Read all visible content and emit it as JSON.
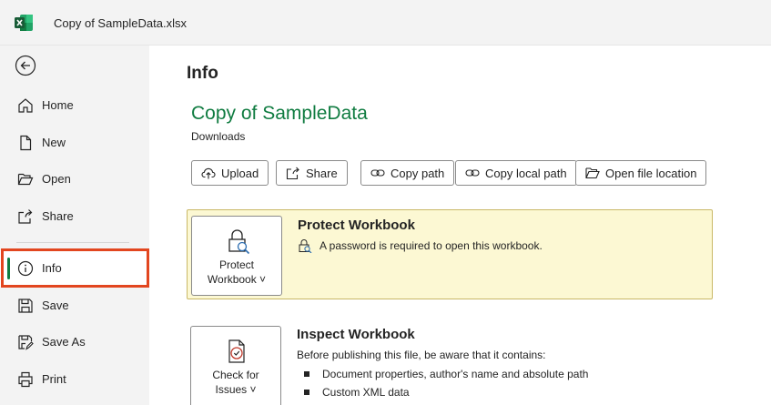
{
  "window": {
    "title": "Copy of SampleData.xlsx",
    "app_icon": "excel-icon"
  },
  "sidebar": {
    "back_icon": "back-arrow-icon",
    "items": [
      {
        "label": "Home",
        "icon": "home-icon"
      },
      {
        "label": "New",
        "icon": "new-document-icon"
      },
      {
        "label": "Open",
        "icon": "folder-open-icon"
      },
      {
        "label": "Share",
        "icon": "share-icon"
      },
      {
        "label": "Info",
        "icon": "info-icon",
        "active": true
      },
      {
        "label": "Save",
        "icon": "save-icon"
      },
      {
        "label": "Save As",
        "icon": "save-as-icon"
      },
      {
        "label": "Print",
        "icon": "print-icon"
      }
    ]
  },
  "main": {
    "title": "Info",
    "document_name": "Copy of SampleData",
    "document_location": "Downloads",
    "actions": [
      {
        "label": "Upload",
        "icon": "upload-icon"
      },
      {
        "label": "Share",
        "icon": "share-icon"
      },
      {
        "label": "Copy path",
        "icon": "link-icon"
      },
      {
        "label": "Copy local path",
        "icon": "link-icon"
      },
      {
        "label": "Open file location",
        "icon": "folder-icon"
      }
    ],
    "protect": {
      "button_line1": "Protect",
      "button_line2": "Workbook ˅",
      "heading": "Protect Workbook",
      "description": "A password is required to open this workbook."
    },
    "inspect": {
      "button_line1": "Check for",
      "button_line2": "Issues ˅",
      "heading": "Inspect Workbook",
      "intro": "Before publishing this file, be aware that it contains:",
      "items": [
        "Document properties, author's name and absolute path",
        "Custom XML data"
      ]
    }
  },
  "colors": {
    "accent": "#107c41",
    "highlight": "#e2461f",
    "protect_bg": "#fcf8d3"
  }
}
